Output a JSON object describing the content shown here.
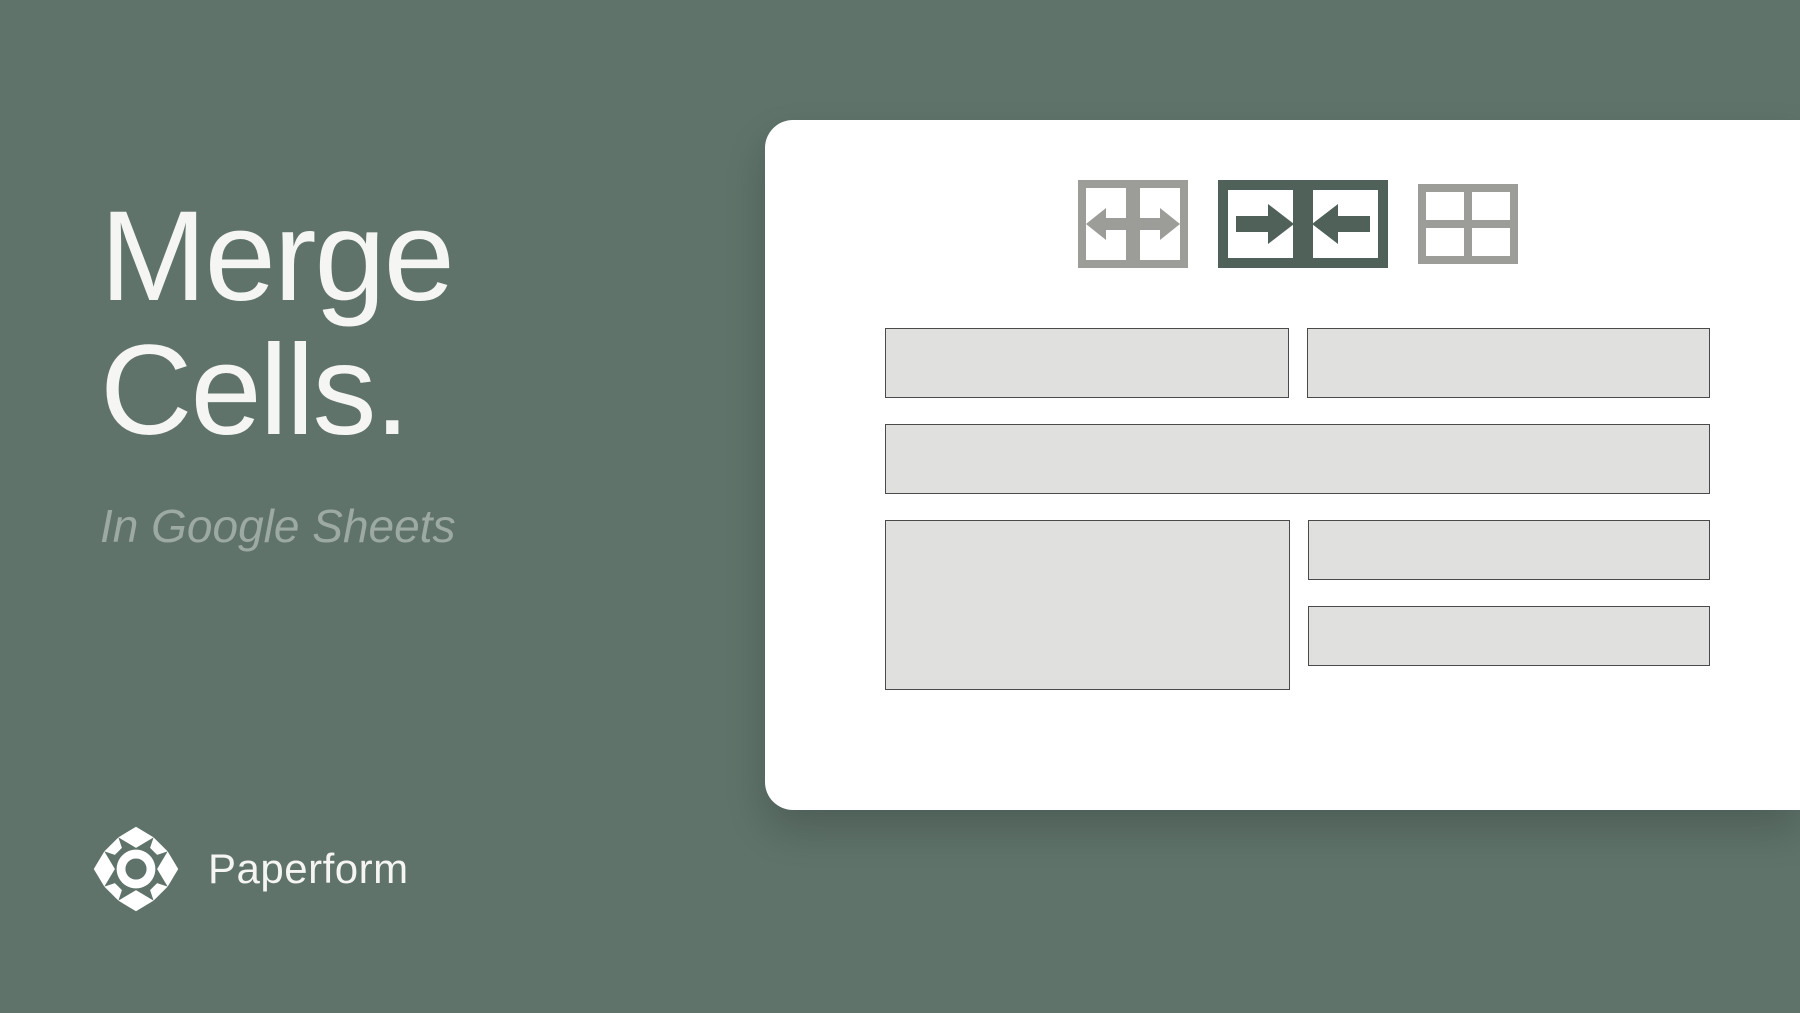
{
  "title_line1": "Merge",
  "title_line2": "Cells.",
  "subtitle": "In Google Sheets",
  "brand": "Paperform",
  "icons": {
    "unmerge": "unmerge-icon",
    "merge_horizontal": "merge-horizontal-icon",
    "grid": "grid-icon"
  },
  "colors": {
    "background": "#5f736a",
    "card": "#ffffff",
    "cell_fill": "#e0e0de",
    "cell_border": "#4a4a4a",
    "icon_inactive": "#9c9c99",
    "icon_active": "#4f6159",
    "text_primary": "#f5f5f3",
    "text_secondary": "#9daaa4"
  }
}
